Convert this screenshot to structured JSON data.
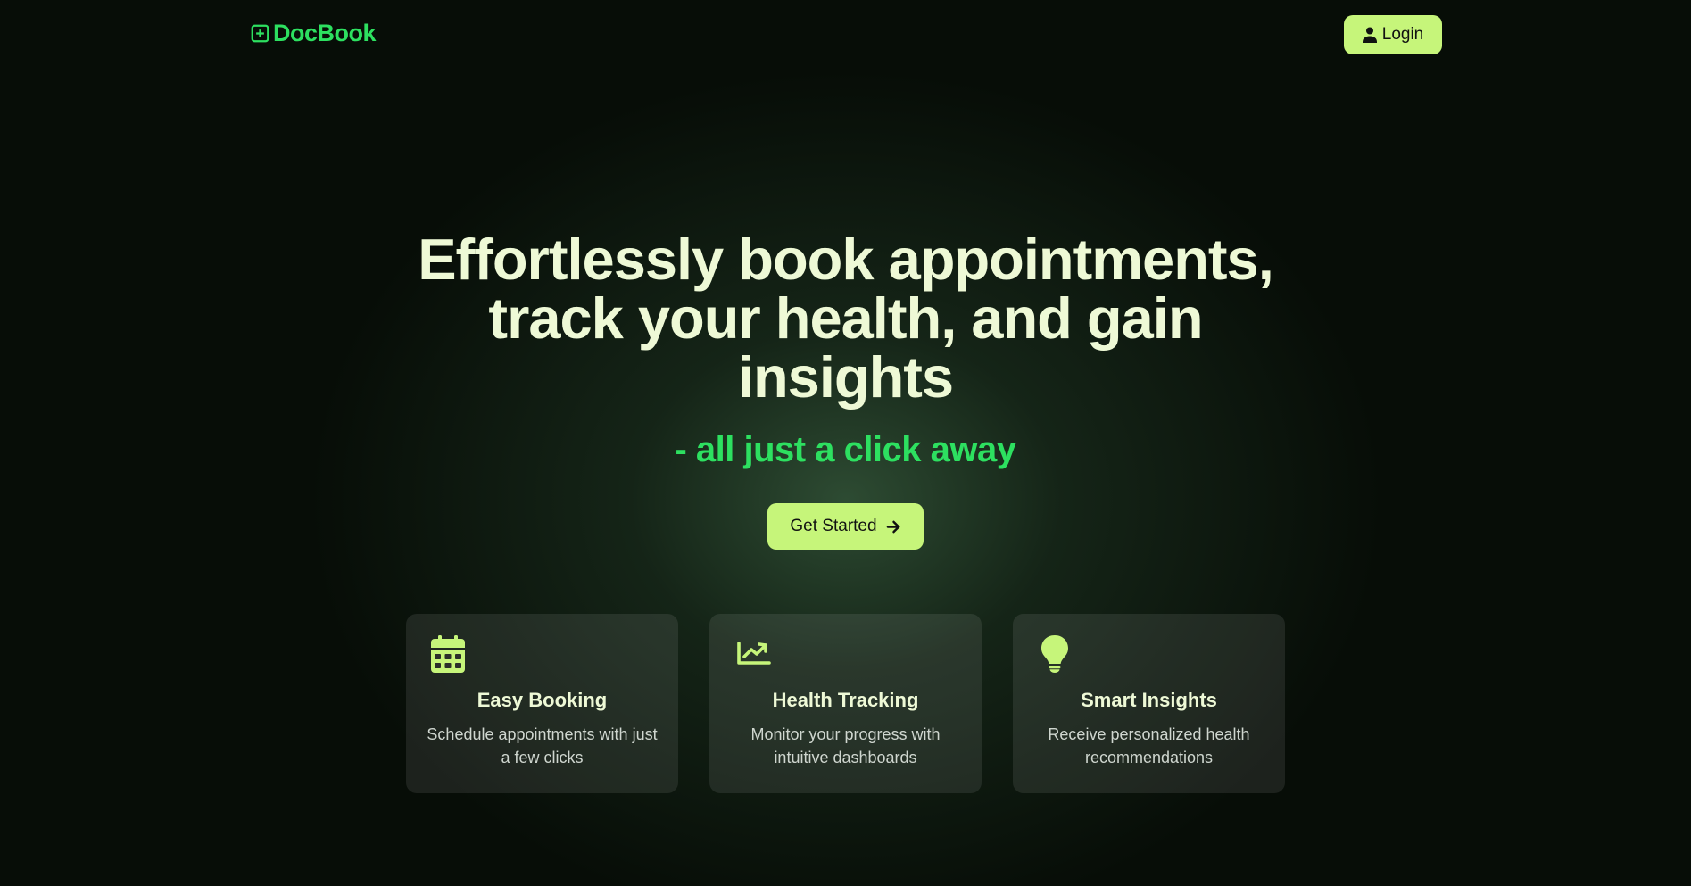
{
  "brand": {
    "name": "DocBook",
    "icon": "plus-square-icon",
    "color": "#2de060"
  },
  "nav": {
    "login_label": "Login",
    "login_icon": "user-icon"
  },
  "hero": {
    "title_lines": [
      "Effortlessly book appointments,",
      "track your health, and gain",
      "insights"
    ],
    "subtitle": "- all just a click away",
    "cta_label": "Get Started",
    "cta_icon": "arrow-right-icon"
  },
  "features": [
    {
      "icon": "calendar-icon",
      "title": "Easy Booking",
      "description": "Schedule appointments with just a few clicks"
    },
    {
      "icon": "chart-line-icon",
      "title": "Health Tracking",
      "description": "Monitor your progress with intuitive dashboards"
    },
    {
      "icon": "lightbulb-icon",
      "title": "Smart Insights",
      "description": "Receive personalized health recommendations"
    }
  ],
  "colors": {
    "accent": "#c6f57a",
    "brand_green": "#2de060",
    "text_light": "#eef9d6",
    "background": "#070d07"
  }
}
